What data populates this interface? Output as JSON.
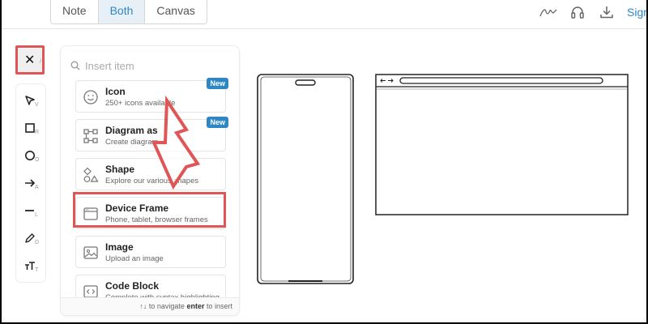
{
  "topbar": {
    "view_modes": [
      "Note",
      "Both",
      "Canvas"
    ],
    "active_mode": "Both",
    "sign_label": "Sign",
    "icons": [
      "signature-icon",
      "headphones-icon",
      "download-icon"
    ]
  },
  "tools": {
    "close": {
      "icon": "close-icon",
      "glyph": "✕",
      "shortcut": "/"
    },
    "items": [
      {
        "name": "select-tool",
        "icon": "pointer-icon",
        "shortcut": "V"
      },
      {
        "name": "rectangle-tool",
        "icon": "square-icon",
        "shortcut": "R"
      },
      {
        "name": "ellipse-tool",
        "icon": "circle-icon",
        "shortcut": "O"
      },
      {
        "name": "arrow-tool",
        "icon": "arrow-right-icon",
        "shortcut": "A"
      },
      {
        "name": "line-tool",
        "icon": "line-icon",
        "shortcut": "L"
      },
      {
        "name": "draw-tool",
        "icon": "pencil-icon",
        "shortcut": "D"
      },
      {
        "name": "text-tool",
        "icon": "text-icon",
        "shortcut": "T"
      }
    ]
  },
  "insert_panel": {
    "search_placeholder": "Insert item",
    "items": [
      {
        "title": "Icon",
        "desc": "250+ icons available",
        "badge": "New",
        "icon": "smiley-icon"
      },
      {
        "title": "Diagram as",
        "desc": "Create diagram",
        "badge": "New",
        "icon": "diagram-icon"
      },
      {
        "title": "Shape",
        "desc": "Explore our various shapes",
        "badge": "",
        "icon": "shapes-icon"
      },
      {
        "title": "Device Frame",
        "desc": "Phone, tablet, browser frames",
        "badge": "",
        "icon": "browser-frame-icon"
      },
      {
        "title": "Image",
        "desc": "Upload an image",
        "badge": "",
        "icon": "image-icon"
      },
      {
        "title": "Code Block",
        "desc": "Complete with syntax highlighting",
        "badge": "",
        "icon": "code-icon"
      }
    ],
    "footer": {
      "arrows": "↑↓",
      "nav": "to navigate",
      "enter": "enter",
      "insert": "to insert"
    }
  },
  "colors": {
    "accent": "#2f86c4",
    "highlight": "#e05555",
    "active_segment_bg": "#e8f0f7"
  }
}
